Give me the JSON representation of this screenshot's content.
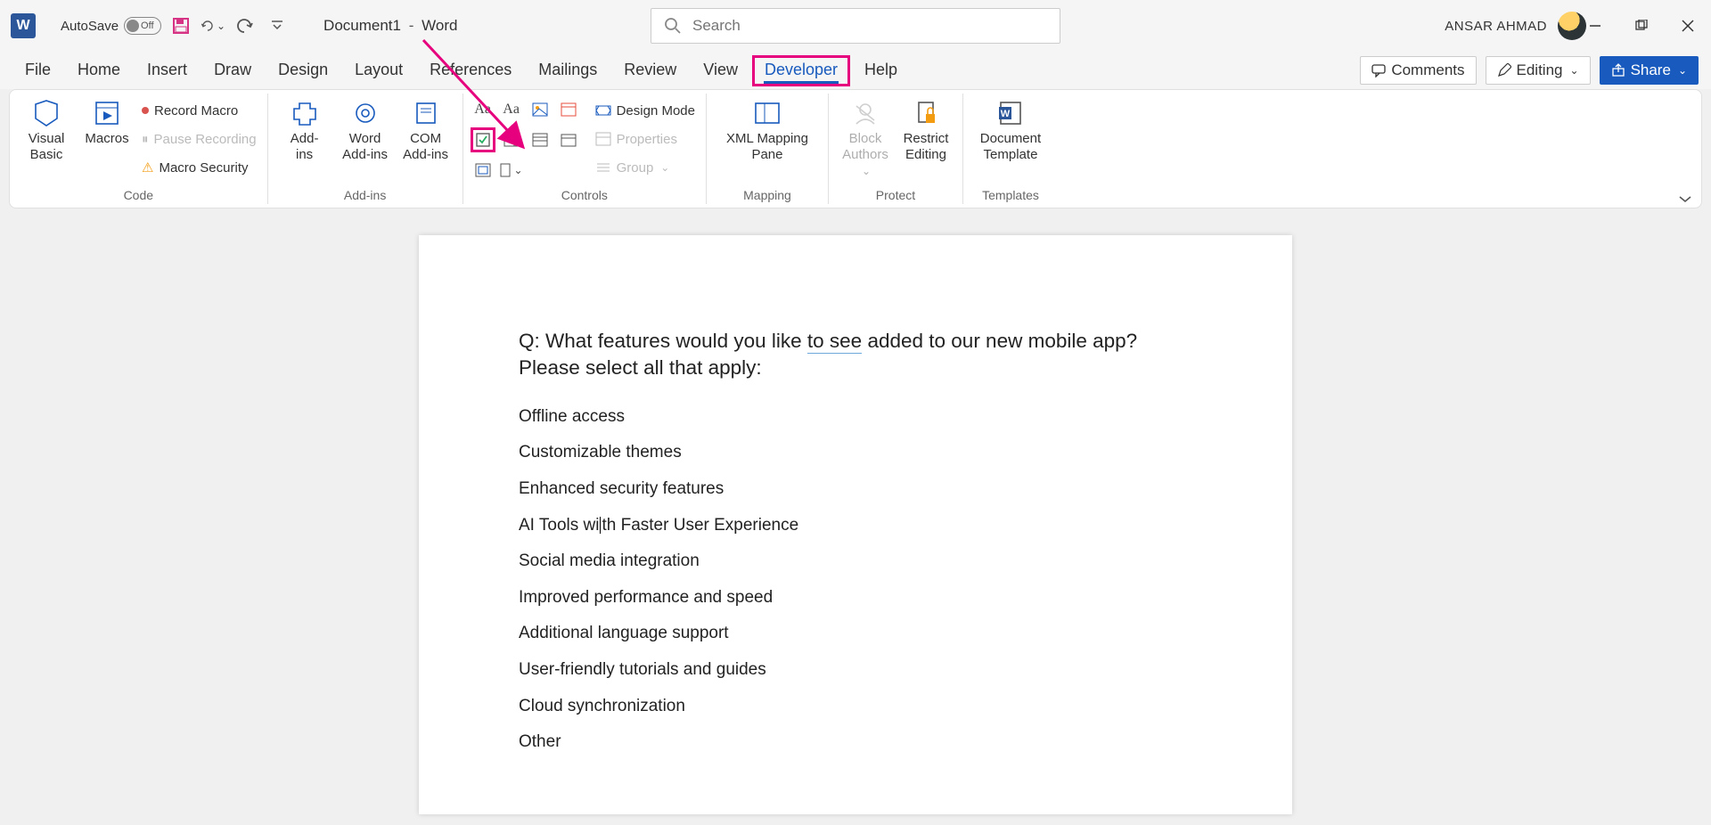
{
  "titlebar": {
    "autosave_label": "AutoSave",
    "autosave_state": "Off",
    "doc_name": "Document1",
    "separator": "-",
    "app_name": "Word",
    "search_placeholder": "Search",
    "username": "ANSAR AHMAD"
  },
  "tabs": {
    "file": "File",
    "home": "Home",
    "insert": "Insert",
    "draw": "Draw",
    "design": "Design",
    "layout": "Layout",
    "references": "References",
    "mailings": "Mailings",
    "review": "Review",
    "view": "View",
    "developer": "Developer",
    "help": "Help",
    "comments": "Comments",
    "editing": "Editing",
    "share": "Share"
  },
  "ribbon": {
    "code": {
      "visual_basic": "Visual\nBasic",
      "macros": "Macros",
      "record": "Record Macro",
      "pause": "Pause Recording",
      "security": "Macro Security",
      "label": "Code"
    },
    "addins": {
      "addins": "Add-\nins",
      "word": "Word\nAdd-ins",
      "com": "COM\nAdd-ins",
      "label": "Add-ins"
    },
    "controls": {
      "design_mode": "Design Mode",
      "properties": "Properties",
      "group": "Group",
      "label": "Controls"
    },
    "mapping": {
      "xml": "XML Mapping\nPane",
      "label": "Mapping"
    },
    "protect": {
      "block": "Block\nAuthors",
      "restrict": "Restrict\nEditing",
      "label": "Protect"
    },
    "templates": {
      "doc": "Document\nTemplate",
      "label": "Templates"
    }
  },
  "document": {
    "question_prefix": "Q: What features would you like ",
    "question_underlined": "to see",
    "question_suffix": " added to our new mobile app? Please select all that apply:",
    "options": [
      "Offline access",
      "Customizable themes",
      "Enhanced security features",
      "AI Tools with Faster User Experience",
      "Social media integration",
      "Improved performance and speed",
      "Additional language support",
      "User-friendly tutorials and guides",
      "Cloud synchronization",
      "Other"
    ]
  },
  "colors": {
    "accent": "#185abd",
    "annotation": "#e6007e"
  }
}
